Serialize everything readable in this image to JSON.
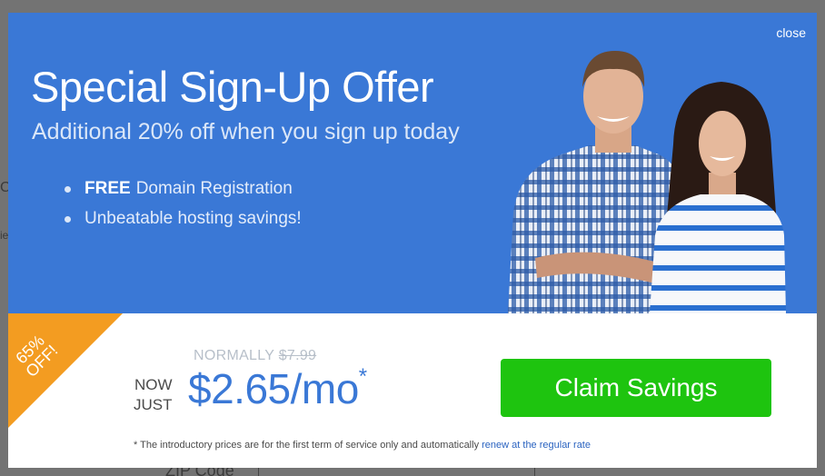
{
  "background": {
    "fragment_a": "C",
    "fragment_b": "ie",
    "fragment_c": "ZIP Code"
  },
  "modal": {
    "close_label": "close",
    "title": "Special Sign-Up Offer",
    "subtitle": "Additional 20% off when you sign up today",
    "features": [
      {
        "strong": "FREE",
        "text": "Domain Registration"
      },
      {
        "strong": "",
        "text": "Unbeatable hosting savings!"
      }
    ],
    "ribbon": {
      "line1": "65%",
      "line2": "OFF!"
    },
    "pricing": {
      "normally_label": "NORMALLY",
      "original_price": "$7.99",
      "now_line1": "NOW",
      "now_line2": "JUST",
      "price": "$2.65/mo",
      "price_asterisk": "*"
    },
    "claim_button_label": "Claim Savings",
    "disclaimer_text": "* The introductory prices are for the first term of service only and automatically",
    "disclaimer_link": "renew at the regular rate"
  },
  "colors": {
    "hero_blue": "#3a78d6",
    "ribbon_orange": "#f39c21",
    "button_green": "#1ec40f",
    "price_blue": "#3a78d6"
  }
}
